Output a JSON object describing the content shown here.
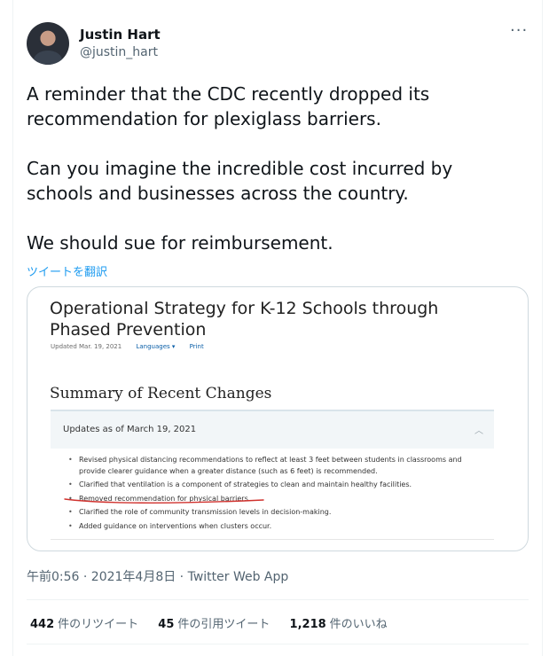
{
  "author": {
    "name": "Justin Hart",
    "handle": "@justin_hart",
    "more_label": "···"
  },
  "tweet": {
    "paragraphs": [
      "A reminder that the CDC recently dropped its recommendation for plexiglass barriers.",
      "Can you imagine the incredible cost incurred by schools and businesses across the country.",
      "We should sue for reimbursement."
    ],
    "translate_label": "ツイートを翻訳"
  },
  "card": {
    "title": "Operational Strategy for K-12 Schools through Phased Prevention",
    "updated": "Updated Mar. 19, 2021",
    "languages": "Languages ▾",
    "print": "Print",
    "summary_title": "Summary of Recent Changes",
    "updates_title": "Updates as of March 19, 2021",
    "updates_caret": "︿",
    "bullets": [
      "Revised physical distancing recommendations to reflect at least 3 feet between students in classrooms and provide clearer guidance when a greater distance (such as 6 feet) is recommended.",
      "Clarified that ventilation is a component of strategies to clean and maintain healthy facilities.",
      "Removed recommendation for physical barriers.",
      "Clarified the role of community transmission levels in decision-making.",
      "Added guidance on interventions when clusters occur."
    ],
    "annotation_color": "#d0312d"
  },
  "meta": {
    "timestamp": "午前0:56 · 2021年4月8日 · Twitter Web App"
  },
  "stats": {
    "retweets_count": "442",
    "retweets_label": "件のリツイート",
    "quotes_count": "45",
    "quotes_label": "件の引用ツイート",
    "likes_count": "1,218",
    "likes_label": "件のいいね"
  }
}
